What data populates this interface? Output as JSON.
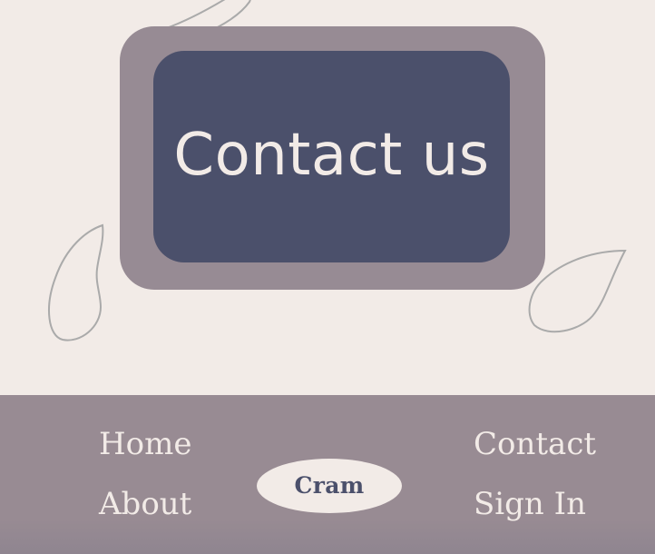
{
  "hero": {
    "title": "Contact us"
  },
  "footer": {
    "nav_left": [
      {
        "label": "Home"
      },
      {
        "label": "About"
      }
    ],
    "brand_label": "Cram",
    "nav_right": [
      {
        "label": "Contact"
      },
      {
        "label": "Sign In"
      }
    ]
  },
  "colors": {
    "background": "#f2ebe7",
    "card_outer": "#978b94",
    "card_inner": "#4b506b",
    "footer": "#988b93",
    "text_light": "#f2ebe7",
    "brand_text": "#4b506b",
    "leaf_outline": "#aaaaaa"
  },
  "icons": [
    "leaf-outline-icon"
  ]
}
